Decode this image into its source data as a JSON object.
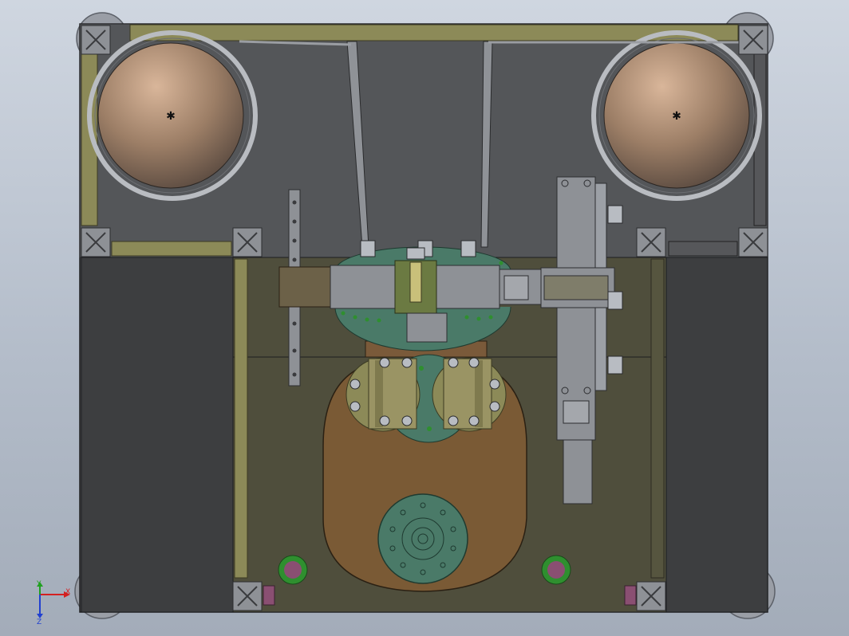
{
  "view": {
    "background_top": "#cfd6e0",
    "background_bottom": "#a3acb9",
    "frame_color": "#4b4c4f",
    "plate_color": "#3d3e40",
    "rail_color": "#8c8a58",
    "drum_color": "#a88a72",
    "gear_color": "#4a7a68",
    "cam_plate_color": "#7a5a35",
    "accent_green": "#2f8f2f",
    "accent_purple": "#8a4f72"
  },
  "triad": {
    "x_label": "X",
    "y_label": "Y",
    "z_label": "Z",
    "x_color": "#d42020",
    "y_color": "#20a020",
    "z_color": "#2040d0"
  },
  "parts": {
    "drum_count": 2,
    "corner_profile_count": 8,
    "bearing_wheel_count": 2
  }
}
